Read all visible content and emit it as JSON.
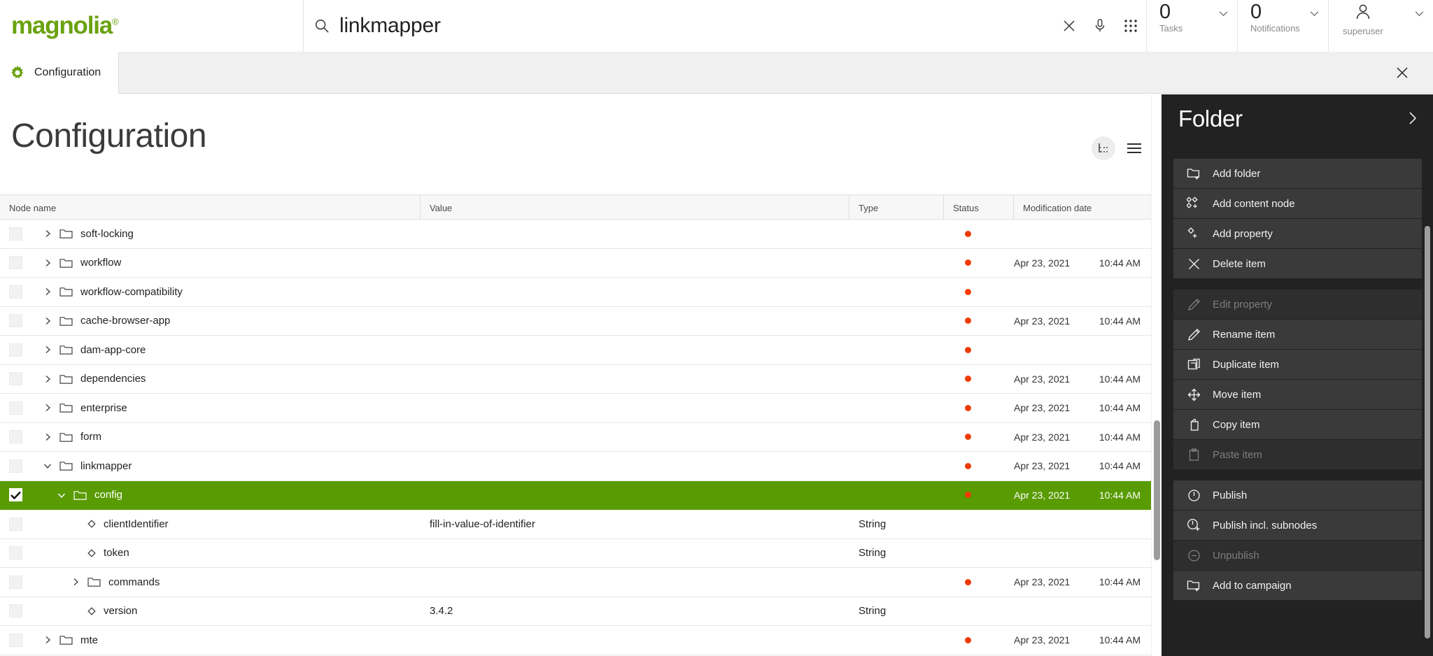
{
  "brand": {
    "name": "magnolia",
    "trademark": "®"
  },
  "search": {
    "value": "linkmapper",
    "icon": "search-icon"
  },
  "topbar": {
    "clear_icon": "close-icon",
    "mic_icon": "microphone-icon",
    "apps_icon": "app-grid-icon",
    "tasks": {
      "count": "0",
      "label": "Tasks"
    },
    "notifications": {
      "count": "0",
      "label": "Notifications"
    },
    "user": {
      "label": "superuser",
      "icon": "user-icon"
    }
  },
  "tabs": {
    "items": [
      {
        "label": "Configuration",
        "icon": "gear-icon",
        "active": true
      }
    ],
    "close_label": "close-tab"
  },
  "page": {
    "title": "Configuration",
    "view_tree_icon": "tree-view-icon",
    "view_list_icon": "list-view-icon"
  },
  "table": {
    "columns": [
      "Node name",
      "Value",
      "Type",
      "Status",
      "Modification date"
    ],
    "rows": [
      {
        "name": "soft-locking",
        "kind": "folder",
        "depth": 0,
        "expanded": false,
        "value": "",
        "type": "",
        "status": "modified",
        "date": "",
        "time": "",
        "selected": false
      },
      {
        "name": "workflow",
        "kind": "folder",
        "depth": 0,
        "expanded": false,
        "value": "",
        "type": "",
        "status": "modified",
        "date": "Apr 23, 2021",
        "time": "10:44 AM",
        "selected": false
      },
      {
        "name": "workflow-compatibility",
        "kind": "folder",
        "depth": 0,
        "expanded": false,
        "value": "",
        "type": "",
        "status": "modified",
        "date": "",
        "time": "",
        "selected": false
      },
      {
        "name": "cache-browser-app",
        "kind": "folder",
        "depth": 0,
        "expanded": false,
        "value": "",
        "type": "",
        "status": "modified",
        "date": "Apr 23, 2021",
        "time": "10:44 AM",
        "selected": false
      },
      {
        "name": "dam-app-core",
        "kind": "folder",
        "depth": 0,
        "expanded": false,
        "value": "",
        "type": "",
        "status": "modified",
        "date": "",
        "time": "",
        "selected": false
      },
      {
        "name": "dependencies",
        "kind": "folder",
        "depth": 0,
        "expanded": false,
        "value": "",
        "type": "",
        "status": "modified",
        "date": "Apr 23, 2021",
        "time": "10:44 AM",
        "selected": false
      },
      {
        "name": "enterprise",
        "kind": "folder",
        "depth": 0,
        "expanded": false,
        "value": "",
        "type": "",
        "status": "modified",
        "date": "Apr 23, 2021",
        "time": "10:44 AM",
        "selected": false
      },
      {
        "name": "form",
        "kind": "folder",
        "depth": 0,
        "expanded": false,
        "value": "",
        "type": "",
        "status": "modified",
        "date": "Apr 23, 2021",
        "time": "10:44 AM",
        "selected": false
      },
      {
        "name": "linkmapper",
        "kind": "folder",
        "depth": 0,
        "expanded": true,
        "value": "",
        "type": "",
        "status": "modified",
        "date": "Apr 23, 2021",
        "time": "10:44 AM",
        "selected": false
      },
      {
        "name": "config",
        "kind": "folder",
        "depth": 1,
        "expanded": true,
        "value": "",
        "type": "",
        "status": "modified",
        "date": "Apr 23, 2021",
        "time": "10:44 AM",
        "selected": true
      },
      {
        "name": "clientIdentifier",
        "kind": "property",
        "depth": 2,
        "expanded": false,
        "value": "fill-in-value-of-identifier",
        "type": "String",
        "status": "",
        "date": "",
        "time": "",
        "selected": false
      },
      {
        "name": "token",
        "kind": "property",
        "depth": 2,
        "expanded": false,
        "value": "",
        "type": "String",
        "status": "",
        "date": "",
        "time": "",
        "selected": false
      },
      {
        "name": "commands",
        "kind": "folder",
        "depth": 2,
        "expanded": false,
        "value": "",
        "type": "",
        "status": "modified",
        "date": "Apr 23, 2021",
        "time": "10:44 AM",
        "selected": false
      },
      {
        "name": "version",
        "kind": "property",
        "depth": 2,
        "expanded": false,
        "value": "3.4.2",
        "type": "String",
        "status": "",
        "date": "",
        "time": "",
        "selected": false
      },
      {
        "name": "mte",
        "kind": "folder",
        "depth": 0,
        "expanded": false,
        "value": "",
        "type": "",
        "status": "modified",
        "date": "Apr 23, 2021",
        "time": "10:44 AM",
        "selected": false
      }
    ]
  },
  "panel": {
    "title": "Folder",
    "expand_icon": "chevron-right-icon",
    "groups": [
      {
        "items": [
          {
            "label": "Add folder",
            "icon": "add-folder-icon",
            "disabled": false
          },
          {
            "label": "Add content node",
            "icon": "add-content-node-icon",
            "disabled": false
          },
          {
            "label": "Add property",
            "icon": "add-property-icon",
            "disabled": false
          },
          {
            "label": "Delete item",
            "icon": "close-icon",
            "disabled": false
          }
        ]
      },
      {
        "items": [
          {
            "label": "Edit property",
            "icon": "pencil-icon",
            "disabled": true
          },
          {
            "label": "Rename item",
            "icon": "pencil-icon",
            "disabled": false
          },
          {
            "label": "Duplicate item",
            "icon": "duplicate-icon",
            "disabled": false
          },
          {
            "label": "Move item",
            "icon": "move-icon",
            "disabled": false
          },
          {
            "label": "Copy item",
            "icon": "copy-icon",
            "disabled": false
          },
          {
            "label": "Paste item",
            "icon": "paste-icon",
            "disabled": true
          }
        ]
      },
      {
        "items": [
          {
            "label": "Publish",
            "icon": "publish-icon",
            "disabled": false
          },
          {
            "label": "Publish incl. subnodes",
            "icon": "publish-subnodes-icon",
            "disabled": false
          },
          {
            "label": "Unpublish",
            "icon": "unpublish-icon",
            "disabled": true
          },
          {
            "label": "Add to campaign",
            "icon": "add-folder-icon",
            "disabled": false
          }
        ]
      }
    ]
  },
  "colors": {
    "brand_green": "#6aa210",
    "selection_green": "#589b02",
    "status_red": "#f03c02",
    "panel_bg": "#222222"
  }
}
